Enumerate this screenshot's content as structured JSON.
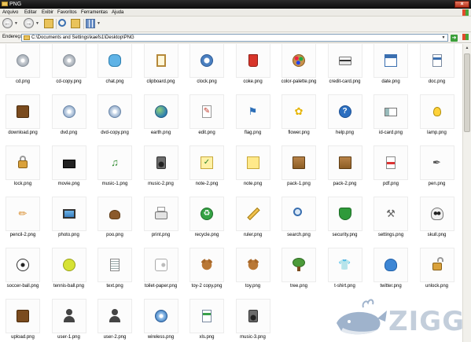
{
  "window": {
    "title": "PNG",
    "close_label": "×"
  },
  "menu": {
    "items": [
      "Arquivo",
      "Editar",
      "Exibir",
      "Favoritos",
      "Ferramentas",
      "Ajuda"
    ]
  },
  "toolbar": {
    "back_icon": "back-arrow-icon",
    "forward_icon": "forward-arrow-icon"
  },
  "address": {
    "label": "Endereço",
    "path": "C:\\Documents and Settings\\kaefs1\\Desktop\\PNG"
  },
  "files": [
    {
      "name": "cd.png",
      "icon": "cd-icon"
    },
    {
      "name": "cd-copy.png",
      "icon": "cd-copy-icon"
    },
    {
      "name": "chat.png",
      "icon": "chat-icon"
    },
    {
      "name": "clipboard.png",
      "icon": "clipboard-icon"
    },
    {
      "name": "clock.png",
      "icon": "clock-icon"
    },
    {
      "name": "coke.png",
      "icon": "coke-icon"
    },
    {
      "name": "color-palette.png",
      "icon": "color-palette-icon"
    },
    {
      "name": "credit-card.png",
      "icon": "credit-card-icon"
    },
    {
      "name": "date.png",
      "icon": "date-icon"
    },
    {
      "name": "doc.png",
      "icon": "doc-icon"
    },
    {
      "name": "download.png",
      "icon": "download-icon"
    },
    {
      "name": "dvd.png",
      "icon": "dvd-icon"
    },
    {
      "name": "dvd-copy.png",
      "icon": "dvd-copy-icon"
    },
    {
      "name": "earth.png",
      "icon": "earth-icon"
    },
    {
      "name": "edit.png",
      "icon": "edit-icon"
    },
    {
      "name": "flag.png",
      "icon": "flag-icon"
    },
    {
      "name": "flower.png",
      "icon": "flower-icon"
    },
    {
      "name": "help.png",
      "icon": "help-icon"
    },
    {
      "name": "id-card.png",
      "icon": "id-card-icon"
    },
    {
      "name": "lamp.png",
      "icon": "lamp-icon"
    },
    {
      "name": "lock.png",
      "icon": "lock-icon"
    },
    {
      "name": "movie.png",
      "icon": "movie-icon"
    },
    {
      "name": "music-1.png",
      "icon": "music-note-icon"
    },
    {
      "name": "music-2.png",
      "icon": "speaker-icon"
    },
    {
      "name": "note-2.png",
      "icon": "note-check-icon"
    },
    {
      "name": "note.png",
      "icon": "note-icon"
    },
    {
      "name": "pack-1.png",
      "icon": "pack-icon"
    },
    {
      "name": "pack-2.png",
      "icon": "pack-icon"
    },
    {
      "name": "pdf.png",
      "icon": "pdf-icon"
    },
    {
      "name": "pen.png",
      "icon": "pen-icon"
    },
    {
      "name": "pencil-2.png",
      "icon": "pencil-icon"
    },
    {
      "name": "photo.png",
      "icon": "photo-icon"
    },
    {
      "name": "poo.png",
      "icon": "poo-icon"
    },
    {
      "name": "print.png",
      "icon": "printer-icon"
    },
    {
      "name": "recycle.png",
      "icon": "recycle-icon"
    },
    {
      "name": "ruler.png",
      "icon": "ruler-icon"
    },
    {
      "name": "search.png",
      "icon": "search-icon"
    },
    {
      "name": "security.png",
      "icon": "shield-icon"
    },
    {
      "name": "settings.png",
      "icon": "settings-icon"
    },
    {
      "name": "skull.png",
      "icon": "skull-icon"
    },
    {
      "name": "soccer-ball.png",
      "icon": "soccer-ball-icon"
    },
    {
      "name": "tennis-ball.png",
      "icon": "tennis-ball-icon"
    },
    {
      "name": "text.png",
      "icon": "text-icon"
    },
    {
      "name": "toilet-paper.png",
      "icon": "toilet-paper-icon"
    },
    {
      "name": "toy-2 copy.png",
      "icon": "teddy-bear-icon"
    },
    {
      "name": "toy.png",
      "icon": "teddy-bear-icon"
    },
    {
      "name": "tree.png",
      "icon": "tree-icon"
    },
    {
      "name": "t-shirt.png",
      "icon": "t-shirt-icon"
    },
    {
      "name": "twitter.png",
      "icon": "twitter-bird-icon"
    },
    {
      "name": "unlock.png",
      "icon": "unlock-icon"
    },
    {
      "name": "upload.png",
      "icon": "upload-icon"
    },
    {
      "name": "user-1.png",
      "icon": "user-icon"
    },
    {
      "name": "user-2.png",
      "icon": "user-icon"
    },
    {
      "name": "wireless.png",
      "icon": "wireless-icon"
    },
    {
      "name": "xls.png",
      "icon": "xls-icon"
    },
    {
      "name": "music-3.png",
      "icon": "speaker-icon"
    }
  ],
  "watermark": {
    "text": "ZIGG"
  }
}
